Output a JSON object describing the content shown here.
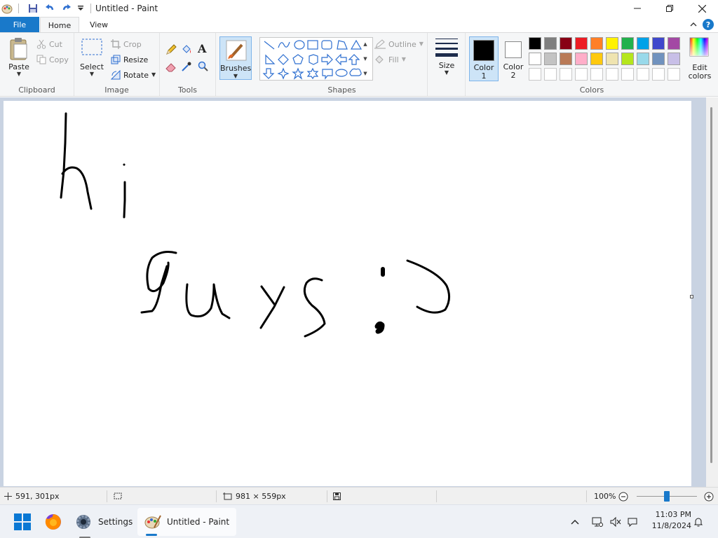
{
  "window": {
    "title": "Untitled - Paint"
  },
  "tabs": {
    "file": "File",
    "home": "Home",
    "view": "View"
  },
  "clipboard": {
    "paste": "Paste",
    "cut": "Cut",
    "copy": "Copy",
    "label": "Clipboard"
  },
  "image": {
    "select": "Select",
    "crop": "Crop",
    "resize": "Resize",
    "rotate": "Rotate",
    "label": "Image"
  },
  "tools": {
    "label": "Tools"
  },
  "brushes": {
    "label": "Brushes"
  },
  "shapes": {
    "outline": "Outline",
    "fill": "Fill",
    "label": "Shapes"
  },
  "size": {
    "label": "Size"
  },
  "colors": {
    "color1_line1": "Color",
    "color1_line2": "1",
    "color2_line1": "Color",
    "color2_line2": "2",
    "edit_line1": "Edit",
    "edit_line2": "colors",
    "label": "Colors",
    "color1_value": "#000000",
    "color2_value": "#ffffff",
    "palette_row1": [
      "#000000",
      "#7f7f7f",
      "#880015",
      "#ed1c24",
      "#ff7f27",
      "#fff200",
      "#22b14c",
      "#00a2e8",
      "#3f48cc",
      "#a349a4"
    ],
    "palette_row2": [
      "#ffffff",
      "#c3c3c3",
      "#b97a57",
      "#ffaec9",
      "#ffc90e",
      "#efe4b0",
      "#b5e61d",
      "#99d9ea",
      "#7092be",
      "#c8bfe7"
    ]
  },
  "status": {
    "cursor_pos": "591, 301px",
    "canvas_size": "981 × 559px",
    "zoom": "100%",
    "zoom_level": 0.5
  },
  "taskbar": {
    "settings": "Settings",
    "paint": "Untitled - Paint",
    "time": "11:03 PM",
    "date": "11/8/2024"
  }
}
